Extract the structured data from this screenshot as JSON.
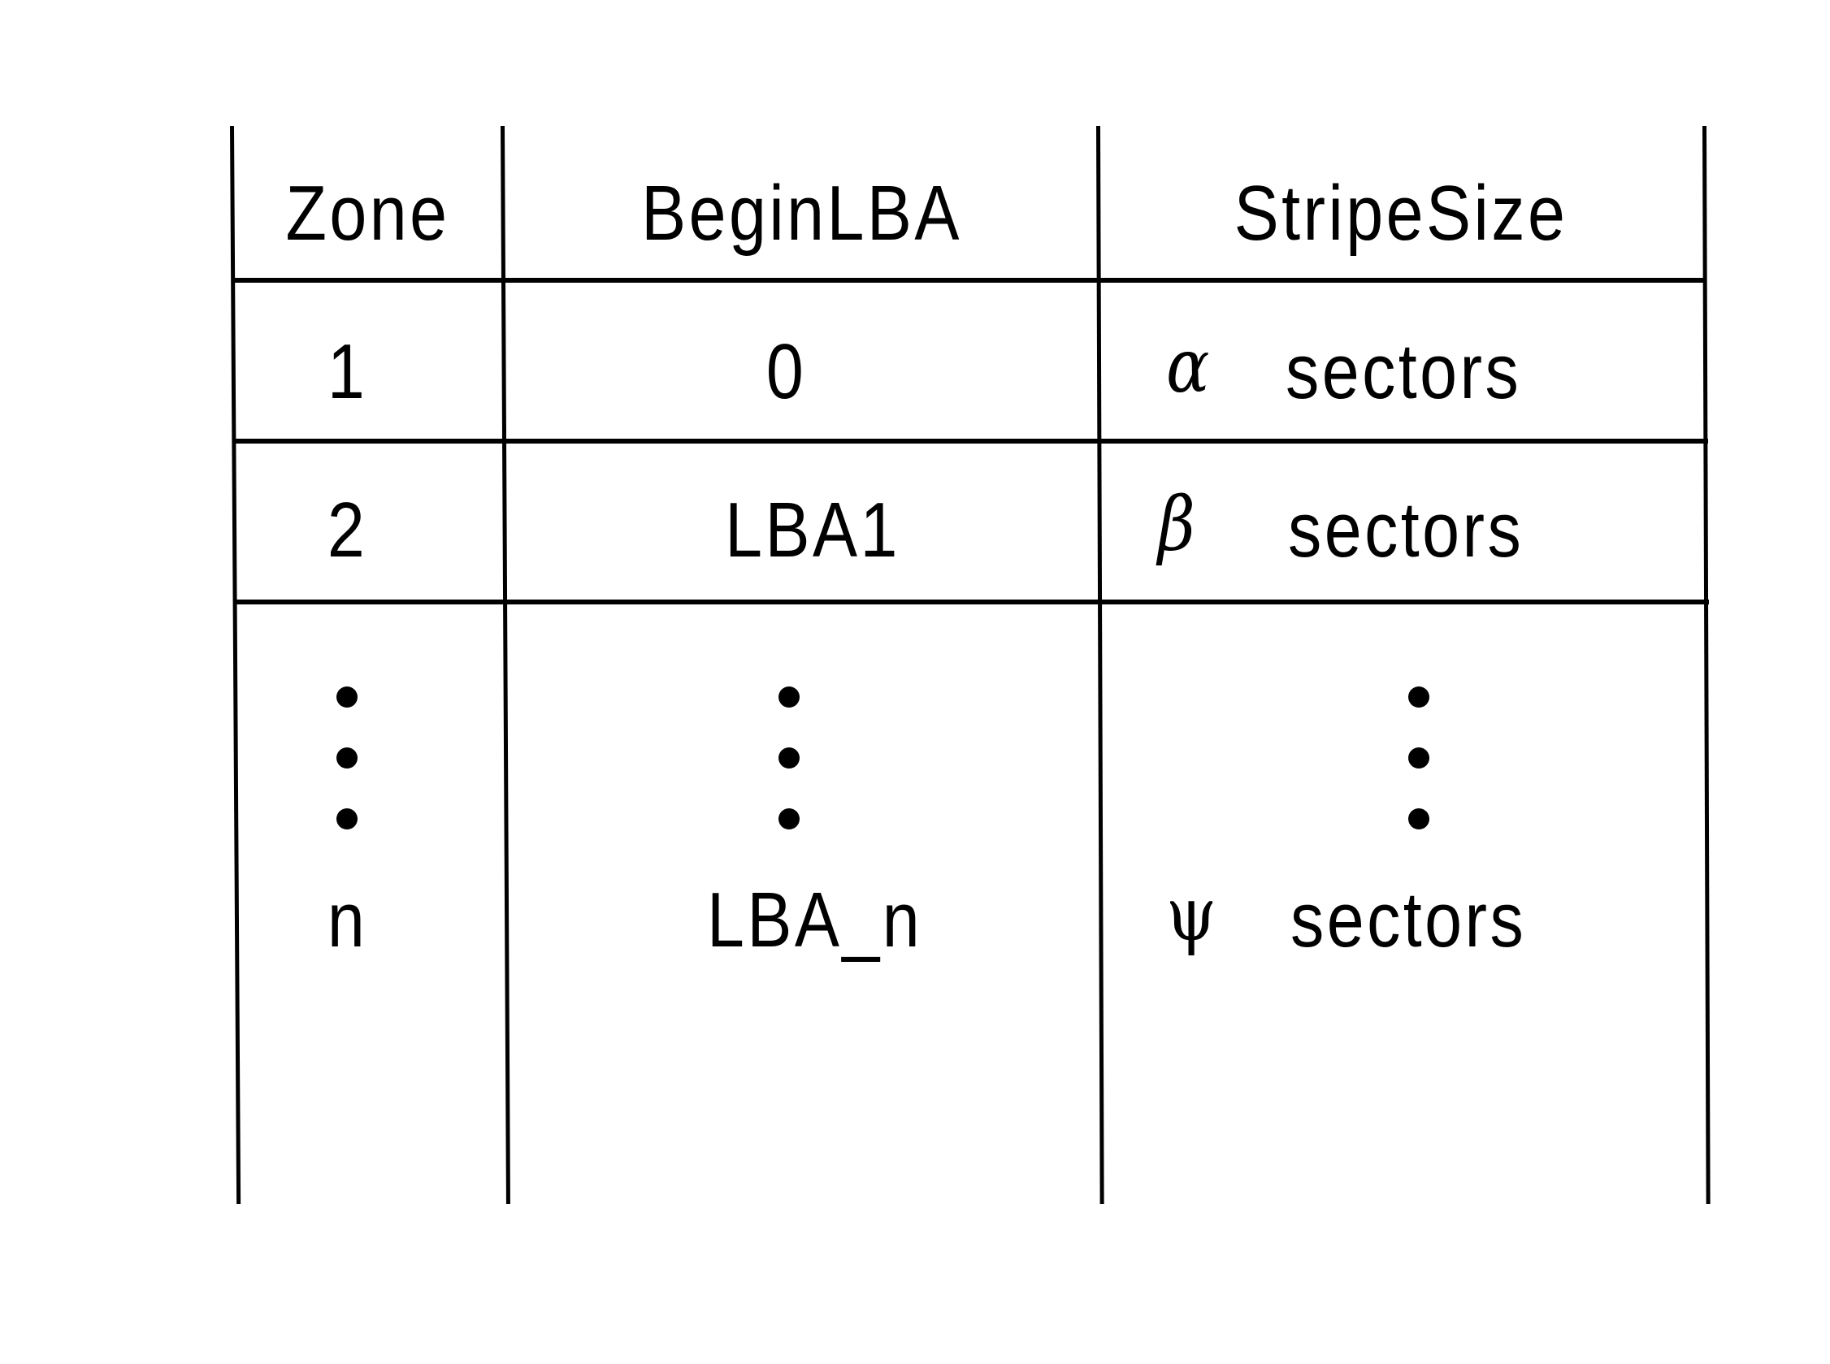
{
  "table": {
    "headers": [
      "Zone",
      "BeginLBA",
      "StripeSize"
    ],
    "rows": [
      {
        "zone": "1",
        "begin_lba": "0",
        "stripe_symbol": "α",
        "stripe_unit": "sectors"
      },
      {
        "zone": "2",
        "begin_lba": "LBA1",
        "stripe_symbol": "β",
        "stripe_unit": "sectors"
      },
      {
        "zone": "n",
        "begin_lba": "LBA_n",
        "stripe_symbol": "ψ",
        "stripe_unit": "sectors"
      }
    ],
    "ellipsis": "vertical-ellipsis"
  }
}
